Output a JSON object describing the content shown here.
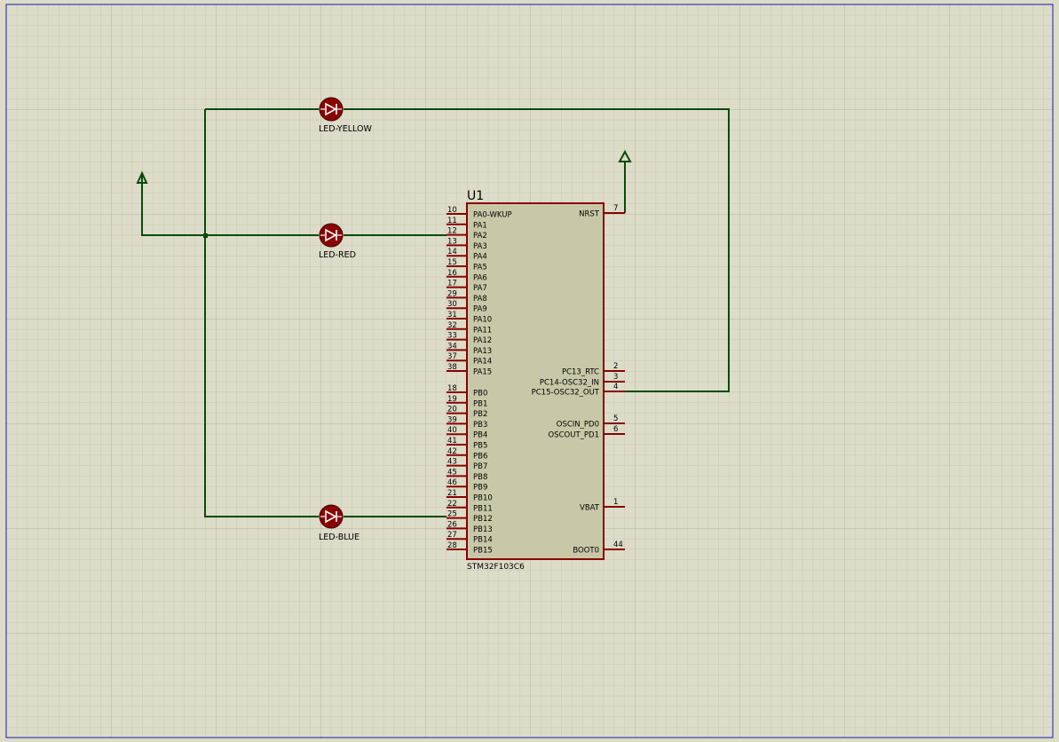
{
  "chip": {
    "ref": "U1",
    "part": "STM32F103C6",
    "left_pins": [
      {
        "num": "10",
        "name": "PA0-WKUP"
      },
      {
        "num": "11",
        "name": "PA1"
      },
      {
        "num": "12",
        "name": "PA2"
      },
      {
        "num": "13",
        "name": "PA3"
      },
      {
        "num": "14",
        "name": "PA4"
      },
      {
        "num": "15",
        "name": "PA5"
      },
      {
        "num": "16",
        "name": "PA6"
      },
      {
        "num": "17",
        "name": "PA7"
      },
      {
        "num": "29",
        "name": "PA8"
      },
      {
        "num": "30",
        "name": "PA9"
      },
      {
        "num": "31",
        "name": "PA10"
      },
      {
        "num": "32",
        "name": "PA11"
      },
      {
        "num": "33",
        "name": "PA12"
      },
      {
        "num": "34",
        "name": "PA13"
      },
      {
        "num": "37",
        "name": "PA14"
      },
      {
        "num": "38",
        "name": "PA15"
      },
      {
        "num": "18",
        "name": "PB0"
      },
      {
        "num": "19",
        "name": "PB1"
      },
      {
        "num": "20",
        "name": "PB2"
      },
      {
        "num": "39",
        "name": "PB3"
      },
      {
        "num": "40",
        "name": "PB4"
      },
      {
        "num": "41",
        "name": "PB5"
      },
      {
        "num": "42",
        "name": "PB6"
      },
      {
        "num": "43",
        "name": "PB7"
      },
      {
        "num": "45",
        "name": "PB8"
      },
      {
        "num": "46",
        "name": "PB9"
      },
      {
        "num": "21",
        "name": "PB10"
      },
      {
        "num": "22",
        "name": "PB11"
      },
      {
        "num": "25",
        "name": "PB12"
      },
      {
        "num": "26",
        "name": "PB13"
      },
      {
        "num": "27",
        "name": "PB14"
      },
      {
        "num": "28",
        "name": "PB15"
      }
    ],
    "right_pins": [
      {
        "num": "7",
        "name": "NRST"
      },
      {
        "num": "2",
        "name": "PC13_RTC"
      },
      {
        "num": "3",
        "name": "PC14-OSC32_IN"
      },
      {
        "num": "4",
        "name": "PC15-OSC32_OUT"
      },
      {
        "num": "5",
        "name": "OSCIN_PD0"
      },
      {
        "num": "6",
        "name": "OSCOUT_PD1"
      },
      {
        "num": "1",
        "name": "VBAT"
      },
      {
        "num": "44",
        "name": "BOOT0"
      }
    ]
  },
  "leds": [
    {
      "label": "LED-YELLOW"
    },
    {
      "label": "LED-RED"
    },
    {
      "label": "LED-BLUE"
    }
  ],
  "colors": {
    "background": "#dcdcc8",
    "grid_minor": "#c8c8b4",
    "grid_major": "#b8b8a4",
    "border": "#1a1aa8",
    "wire": "#0a4a0a",
    "chip_fill": "#c8c8a8",
    "chip_outline": "#8b0000",
    "pin": "#8b0000",
    "led_fill": "#8b0000"
  }
}
